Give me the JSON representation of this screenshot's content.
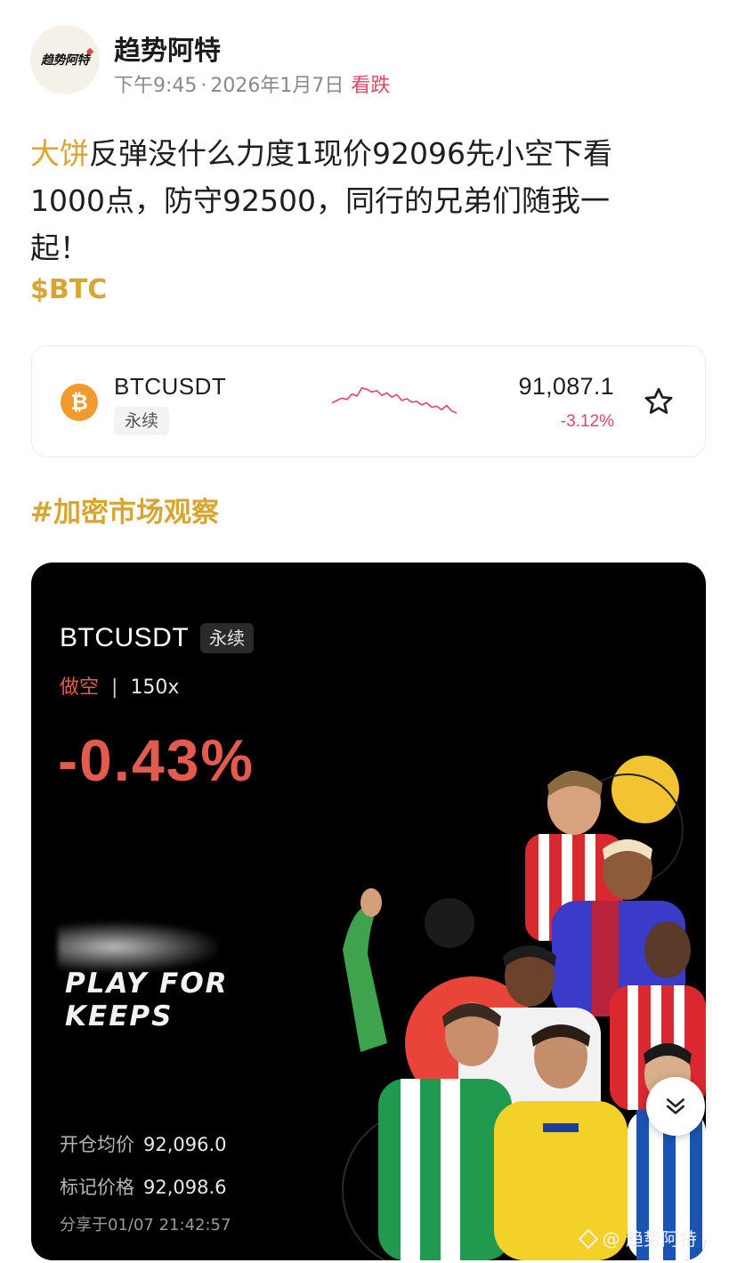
{
  "post": {
    "author": "趋势阿特",
    "avatar_text": "趋势阿特",
    "time": "下午9:45",
    "date": "2026年1月7日",
    "sentiment": "看跌",
    "text_highlight": "大饼",
    "text_line1": "反弹没什么力度1现价92096先小空下看",
    "text_line2": "1000点，防守92500，同行的兄弟们随我一",
    "text_line3": "起！",
    "cashtag": "$BTC",
    "topic": "#加密市场观察"
  },
  "ticker": {
    "symbol": "BTCUSDT",
    "type": "永续",
    "coin_letter": "₿",
    "price": "91,087.1",
    "change": "-3.12%",
    "sparkline": [
      0.62,
      0.55,
      0.48,
      0.52,
      0.36,
      0.42,
      0.18,
      0.22,
      0.3,
      0.26,
      0.4,
      0.33,
      0.45,
      0.38,
      0.55,
      0.5,
      0.6,
      0.58,
      0.68,
      0.62,
      0.75,
      0.72,
      0.82,
      0.7,
      0.86,
      0.92
    ],
    "favorite_icon": "star-outline-icon"
  },
  "share_card": {
    "symbol": "BTCUSDT",
    "type": "永续",
    "side": "做空",
    "leverage": "150x",
    "pnl": "-0.43%",
    "promo_line1": "PLAY FOR",
    "promo_line2": "KEEPS",
    "entry_label": "开仓均价",
    "entry_value": "92,096.0",
    "mark_label": "标记价格",
    "mark_value": "92,098.6",
    "shared_at": "分享于01/07 21:42:57",
    "watermark": "@ 趋势阿特"
  },
  "colors": {
    "accent_gold": "#d9a532",
    "down_red": "#e0465e",
    "pnl_red": "#e25b4f",
    "btc_orange": "#f39a2c"
  },
  "scroll_button_icon": "double-chevron-down-icon"
}
